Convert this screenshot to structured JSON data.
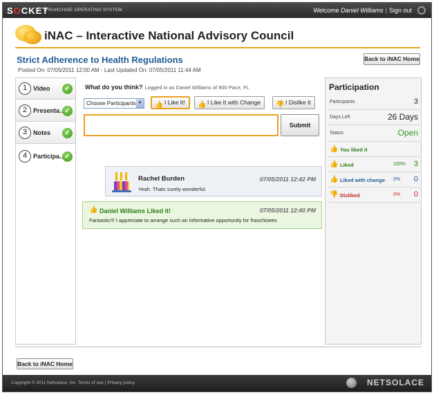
{
  "topbar": {
    "brand_pre": "S",
    "brand_o": "O",
    "brand_post": "CKET",
    "brand_sub": "FRANCHISE OPERATING SYSTEM",
    "welcome": "Welcome",
    "user": "Daniel Williams",
    "separator": "|",
    "signout": "Sign out"
  },
  "header": {
    "title": "iNAC – Interactive National Advisory Council"
  },
  "topic": {
    "title": "Strict Adherence to Health Regulations",
    "posted": "Posted On: 07/05/2011 12:00 AM - Last Updated On: 07/05/2011 11:44 AM",
    "back_label": "Back to iNAC Home"
  },
  "steps": [
    {
      "num": "1",
      "label": "Video"
    },
    {
      "num": "2",
      "label": "Presenta..."
    },
    {
      "num": "3",
      "label": "Notes"
    },
    {
      "num": "4",
      "label": "Participa..."
    }
  ],
  "feedback": {
    "question": "What do you think?",
    "logged_in": "Logged in as Daniel Williams of 900 Pace, FL",
    "select_value": "Choose Participants",
    "like": "I Like It!",
    "like_change": "I Like It with Change",
    "dislike": "I Dislike It",
    "submit": "Submit"
  },
  "posts": [
    {
      "name": "Rachel Burden",
      "time": "07/05/2011 12:42 PM",
      "text": "Yeah. Thats surely wonderful."
    },
    {
      "name": "Daniel Williams Liked it!",
      "time": "07/05/2011 12:40 PM",
      "text": "Fantastic!!! I appreciate to arrange such an informative opportunity for franchisees"
    }
  ],
  "participation": {
    "title": "Participation",
    "participants_label": "Participants",
    "participants": "3",
    "days_left_label": "Days Left",
    "days_left": "26 Days",
    "status_label": "Status",
    "status": "Open",
    "you_liked": "You liked it",
    "liked_label": "Liked",
    "liked_pct": "100%",
    "liked_n": "3",
    "liked_change_label": "Liked with change",
    "liked_change_pct": "0%",
    "liked_change_n": "0",
    "disliked_label": "Disliked",
    "disliked_pct": "0%",
    "disliked_n": "0"
  },
  "footer": {
    "copyright": "Copyright © 2011 Netsolace, Inc. Terms of use | Privacy policy",
    "logo": "NETSOLACE"
  },
  "colors": {
    "accent": "#e8a21f",
    "title_blue": "#1f5b94",
    "green": "#2e7d16",
    "red": "#c0282c"
  }
}
